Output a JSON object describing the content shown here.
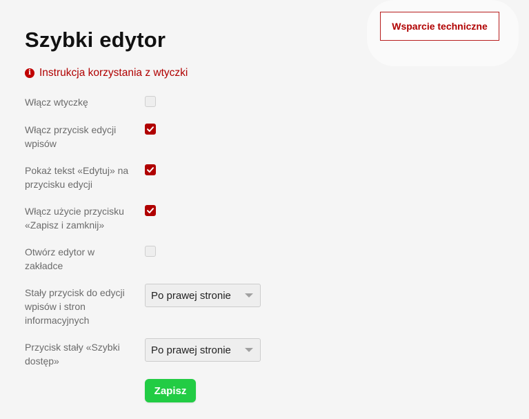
{
  "header": {
    "title": "Szybki edytor",
    "support_label": "Wsparcie techniczne"
  },
  "instructions_link": {
    "label": "Instrukcja korzystania z wtyczki",
    "icon": "info-icon"
  },
  "settings": [
    {
      "label": "Włącz wtyczkę",
      "type": "checkbox",
      "checked": false
    },
    {
      "label": "Włącz przycisk edycji wpisów",
      "type": "checkbox",
      "checked": true
    },
    {
      "label": "Pokaż tekst «Edytuj» na przycisku edycji",
      "type": "checkbox",
      "checked": true
    },
    {
      "label": "Włącz użycie przycisku «Zapisz i zamknij»",
      "type": "checkbox",
      "checked": true
    },
    {
      "label": "Otwórz edytor w zakładce",
      "type": "checkbox",
      "checked": false
    },
    {
      "label": "Stały przycisk do edycji wpisów i stron informacyjnych",
      "type": "select",
      "value": "Po prawej stronie"
    },
    {
      "label": "Przycisk stały «Szybki dostęp»",
      "type": "select",
      "value": "Po prawej stronie"
    }
  ],
  "save_label": "Zapisz",
  "colors": {
    "accent": "#b00000",
    "save": "#22cc44",
    "background": "#f5f5f5"
  }
}
